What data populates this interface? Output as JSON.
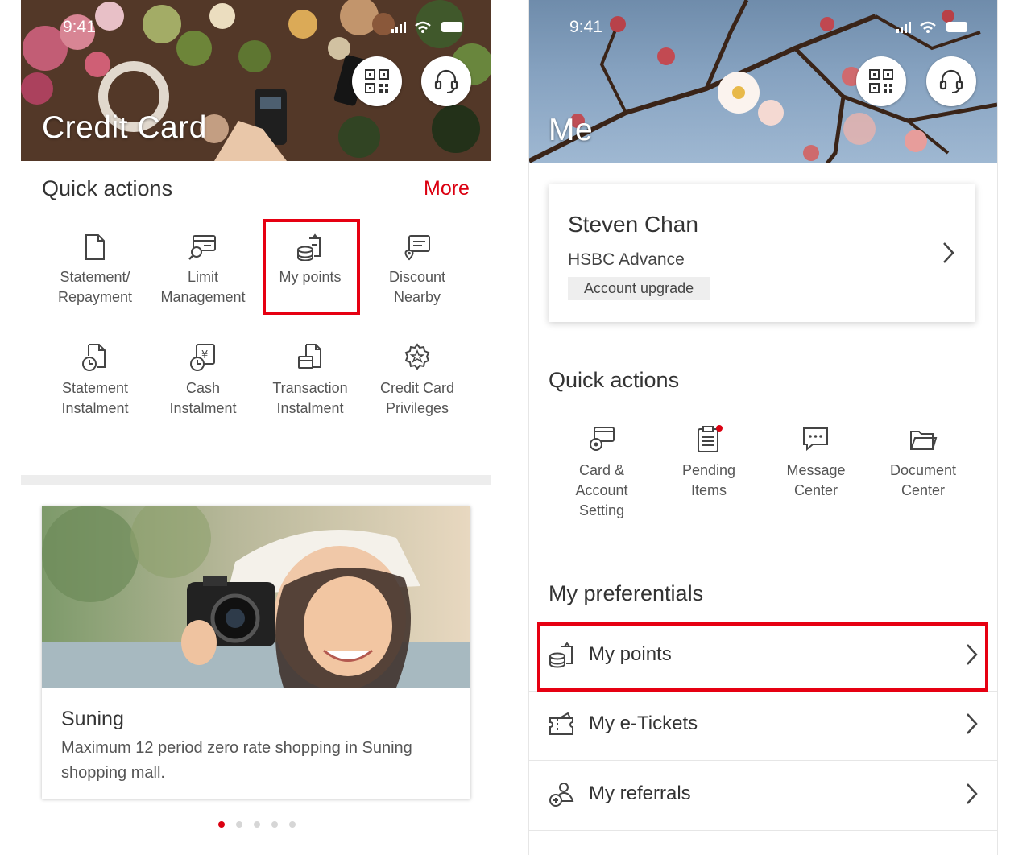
{
  "left_screen": {
    "status_time": "9:41",
    "hero_title": "Credit Card",
    "qr_icon": "qr-code-icon",
    "support_icon": "headset-icon",
    "quick_actions_title": "Quick actions",
    "more_label": "More",
    "actions": [
      {
        "label_line1": "Statement/",
        "label_line2": "Repayment",
        "icon": "statement-icon"
      },
      {
        "label_line1": "Limit",
        "label_line2": "Management",
        "icon": "limit-icon"
      },
      {
        "label_line1": "My points",
        "label_line2": "",
        "icon": "coins-icon"
      },
      {
        "label_line1": "Discount",
        "label_line2": "Nearby",
        "icon": "discount-icon"
      },
      {
        "label_line1": "Statement",
        "label_line2": "Instalment",
        "icon": "statement-instalment-icon"
      },
      {
        "label_line1": "Cash",
        "label_line2": "Instalment",
        "icon": "cash-instalment-icon"
      },
      {
        "label_line1": "Transaction",
        "label_line2": "Instalment",
        "icon": "transaction-instalment-icon"
      },
      {
        "label_line1": "Credit Card",
        "label_line2": "Privileges",
        "icon": "privileges-icon"
      }
    ],
    "promo": {
      "title": "Suning",
      "description": "Maximum 12 period zero rate shopping in Suning shopping mall."
    },
    "pagination": {
      "total": 5,
      "active": 1
    }
  },
  "right_screen": {
    "status_time": "9:41",
    "hero_title": "Me",
    "profile": {
      "name": "Steven Chan",
      "tier": "HSBC Advance",
      "upgrade_label": "Account upgrade"
    },
    "quick_actions_title": "Quick actions",
    "actions": [
      {
        "label_line1": "Card &",
        "label_line2": "Account",
        "label_line3": "Setting",
        "icon": "card-setting-icon"
      },
      {
        "label_line1": "Pending",
        "label_line2": "Items",
        "label_line3": "",
        "icon": "pending-items-icon"
      },
      {
        "label_line1": "Message",
        "label_line2": "Center",
        "label_line3": "",
        "icon": "message-icon"
      },
      {
        "label_line1": "Document",
        "label_line2": "Center",
        "label_line3": "",
        "icon": "folder-icon"
      }
    ],
    "preferentials_title": "My preferentials",
    "preferentials": [
      {
        "label": "My points",
        "icon": "coins-icon"
      },
      {
        "label": "My e-Tickets",
        "icon": "ticket-icon"
      },
      {
        "label": "My referrals",
        "icon": "referrals-icon"
      }
    ]
  },
  "colors": {
    "accent_red": "#db0011",
    "highlight_red": "#e60012"
  }
}
